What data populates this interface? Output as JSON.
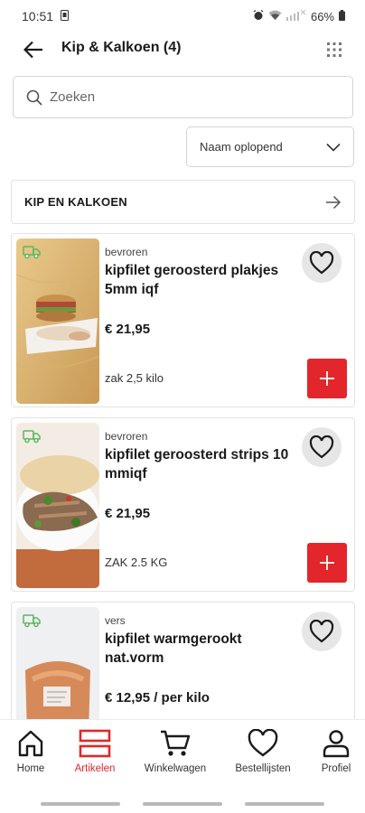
{
  "status_bar": {
    "time": "10:51",
    "battery": "66%"
  },
  "header": {
    "title": "Kip & Kalkoen (4)"
  },
  "search": {
    "placeholder": "Zoeken"
  },
  "sort": {
    "selected": "Naam oplopend"
  },
  "category": {
    "label": "KIP EN KALKOEN"
  },
  "products": [
    {
      "tag": "bevroren",
      "name": "kipfilet geroosterd plakjes 5mm iqf",
      "price": "€ 21,95",
      "unit": "zak 2,5 kilo"
    },
    {
      "tag": "bevroren",
      "name": "kipfilet geroosterd strips 10 mmiqf",
      "price": "€ 21,95",
      "unit": "ZAK 2.5 KG"
    },
    {
      "tag": "vers",
      "name": "kipfilet warmgerookt nat.vorm",
      "price": "€ 12,95 / per kilo",
      "unit": ""
    }
  ],
  "nav": {
    "home": "Home",
    "artikelen": "Artikelen",
    "winkelwagen": "Winkelwagen",
    "bestellijsten": "Bestellijsten",
    "profiel": "Profiel"
  },
  "colors": {
    "accent": "#e3262b",
    "delivery_icon": "#4caf50"
  }
}
